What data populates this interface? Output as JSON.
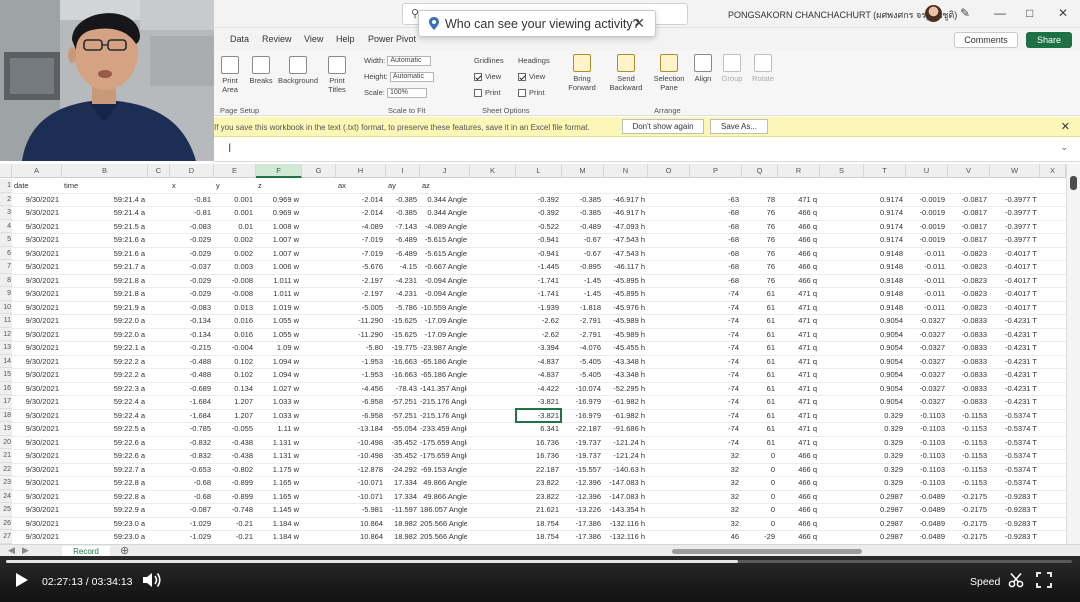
{
  "titlebar": {
    "account_name": "PONGSAKORN CHANCHACHURT (ผศพงศกร จรฐานชูติ)",
    "tooltip_text": "Who can see your viewing activity?"
  },
  "ribbon": {
    "tabs": [
      "Data",
      "Review",
      "View",
      "Help",
      "Power Pivot"
    ],
    "comments_label": "Comments",
    "share_label": "Share",
    "buttons": {
      "print_area": "Print Area",
      "breaks": "Breaks",
      "background": "Background",
      "print_titles": "Print Titles",
      "bring_forward": "Bring Forward",
      "send_backward": "Send Backward",
      "selection_pane": "Selection Pane",
      "align": "Align",
      "group": "Group",
      "rotate": "Rotate"
    },
    "scale_to_fit": {
      "width_label": "Width:",
      "width_value": "Automatic",
      "height_label": "Height:",
      "height_value": "Automatic",
      "scale_label": "Scale:",
      "scale_value": "100%"
    },
    "sheet_options": {
      "gridlines": "Gridlines",
      "headings": "Headings",
      "view": "View",
      "print": "Print"
    },
    "groups": {
      "page_setup": "Page Setup",
      "scale_to_fit": "Scale to Fit",
      "sheet_options": "Sheet Options",
      "arrange": "Arrange"
    }
  },
  "message_bar": {
    "text": "If you save this workbook in the text (.txt) format, to preserve these features, save it in an Excel file format.",
    "dont_show": "Don't show again",
    "save_as": "Save As..."
  },
  "grid": {
    "columns": [
      "A",
      "B",
      "C",
      "D",
      "E",
      "F",
      "G",
      "H",
      "I",
      "J",
      "K",
      "L",
      "M",
      "N",
      "O",
      "P",
      "Q",
      "R",
      "S",
      "T",
      "U",
      "V",
      "W",
      "X"
    ],
    "selected_column": "F",
    "header_row": {
      "A": "date",
      "B": "time",
      "D": "x",
      "E": "y",
      "F": "z",
      "H": "ax",
      "I": "ay",
      "J": "az"
    },
    "rows": [
      {
        "n": "2",
        "A": "9/30/2021",
        "B": "59:21.4 a",
        "D": "-0.81",
        "E": "0.001",
        "F": "0.969 w",
        "H": "-2.014",
        "I": "-0.385",
        "J": "0.344 Angle",
        "L": "-0.392",
        "M": "-0.385",
        "N": "-46.917 h",
        "P": "-63",
        "Q": "78",
        "R": "471 q",
        "T": "0.9174",
        "U": "-0.0019",
        "V": "-0.0817",
        "W": "-0.3977 T"
      },
      {
        "n": "3",
        "A": "9/30/2021",
        "B": "59:21.4 a",
        "D": "-0.81",
        "E": "0.001",
        "F": "0.969 w",
        "H": "-2.014",
        "I": "-0.385",
        "J": "0.344 Angle",
        "L": "-0.392",
        "M": "-0.385",
        "N": "-46.917 h",
        "P": "-68",
        "Q": "76",
        "R": "466 q",
        "T": "0.9174",
        "U": "-0.0019",
        "V": "-0.0817",
        "W": "-0.3977 T"
      },
      {
        "n": "4",
        "A": "9/30/2021",
        "B": "59:21.5 a",
        "D": "-0.083",
        "E": "0.01",
        "F": "1.008 w",
        "H": "-4.089",
        "I": "-7.143",
        "J": "-4.089 Angle",
        "L": "-0.522",
        "M": "-0.489",
        "N": "-47.093 h",
        "P": "-68",
        "Q": "76",
        "R": "466 q",
        "T": "0.9174",
        "U": "-0.0019",
        "V": "-0.0817",
        "W": "-0.3977 T"
      },
      {
        "n": "5",
        "A": "9/30/2021",
        "B": "59:21.6 a",
        "D": "-0.029",
        "E": "0.002",
        "F": "1.007 w",
        "H": "-7.019",
        "I": "-6.489",
        "J": "-5.615 Angle",
        "L": "-0.941",
        "M": "-0.67",
        "N": "-47.543 h",
        "P": "-68",
        "Q": "76",
        "R": "466 q",
        "T": "0.9174",
        "U": "-0.0019",
        "V": "-0.0817",
        "W": "-0.3977 T"
      },
      {
        "n": "6",
        "A": "9/30/2021",
        "B": "59:21.6 a",
        "D": "-0.029",
        "E": "0.002",
        "F": "1.007 w",
        "H": "-7.019",
        "I": "-6.489",
        "J": "-5.615 Angle",
        "L": "-0.941",
        "M": "-0.67",
        "N": "-47.543 h",
        "P": "-68",
        "Q": "76",
        "R": "466 q",
        "T": "0.9148",
        "U": "-0.011",
        "V": "-0.0823",
        "W": "-0.4017 T"
      },
      {
        "n": "7",
        "A": "9/30/2021",
        "B": "59:21.7 a",
        "D": "-0.037",
        "E": "0.003",
        "F": "1.006 w",
        "H": "-5.676",
        "I": "-4.15",
        "J": "-0.667 Angle",
        "L": "-1.445",
        "M": "-0.895",
        "N": "-46.117 h",
        "P": "-68",
        "Q": "76",
        "R": "466 q",
        "T": "0.9148",
        "U": "-0.011",
        "V": "-0.0823",
        "W": "-0.4017 T"
      },
      {
        "n": "8",
        "A": "9/30/2021",
        "B": "59:21.8 a",
        "D": "-0.029",
        "E": "-0.008",
        "F": "1.011 w",
        "H": "-2.197",
        "I": "-4.231",
        "J": "-0.094 Angle",
        "L": "-1.741",
        "M": "-1.45",
        "N": "-45.895 h",
        "P": "-68",
        "Q": "76",
        "R": "466 q",
        "T": "0.9148",
        "U": "-0.011",
        "V": "-0.0823",
        "W": "-0.4017 T"
      },
      {
        "n": "9",
        "A": "9/30/2021",
        "B": "59:21.8 a",
        "D": "-0.029",
        "E": "-0.008",
        "F": "1.011 w",
        "H": "-2.197",
        "I": "-4.231",
        "J": "-0.094 Angle",
        "L": "-1.741",
        "M": "-1.45",
        "N": "-45.895 h",
        "P": "-74",
        "Q": "61",
        "R": "471 q",
        "T": "0.9148",
        "U": "-0.011",
        "V": "-0.0823",
        "W": "-0.4017 T"
      },
      {
        "n": "10",
        "A": "9/30/2021",
        "B": "59:21.9 a",
        "D": "-0.083",
        "E": "0.013",
        "F": "1.019 w",
        "H": "-5.005",
        "I": "-5.786",
        "J": "-10.559 Angle",
        "L": "-1.939",
        "M": "-1.818",
        "N": "-45.976 h",
        "P": "-74",
        "Q": "61",
        "R": "471 q",
        "T": "0.9148",
        "U": "-0.011",
        "V": "-0.0823",
        "W": "-0.4017 T"
      },
      {
        "n": "11",
        "A": "9/30/2021",
        "B": "59:22.0 a",
        "D": "-0.134",
        "E": "0.016",
        "F": "1.055 w",
        "H": "-11.290",
        "I": "-15.625",
        "J": "-17.09 Angle",
        "L": "-2.62",
        "M": "-2.791",
        "N": "-45.989 h",
        "P": "-74",
        "Q": "61",
        "R": "471 q",
        "T": "0.9054",
        "U": "-0.0327",
        "V": "-0.0833",
        "W": "-0.4231 T"
      },
      {
        "n": "12",
        "A": "9/30/2021",
        "B": "59:22.0 a",
        "D": "-0.134",
        "E": "0.016",
        "F": "1.055 w",
        "H": "-11.290",
        "I": "-15.625",
        "J": "-17.09 Angle",
        "L": "-2.62",
        "M": "-2.791",
        "N": "-45.989 h",
        "P": "-74",
        "Q": "61",
        "R": "471 q",
        "T": "0.9054",
        "U": "-0.0327",
        "V": "-0.0833",
        "W": "-0.4231 T"
      },
      {
        "n": "13",
        "A": "9/30/2021",
        "B": "59:22.1 a",
        "D": "-0.215",
        "E": "-0.004",
        "F": "1.09 w",
        "H": "-5.80",
        "I": "-19.775",
        "J": "-23.987 Angle",
        "L": "-3.394",
        "M": "-4.076",
        "N": "-45.455 h",
        "P": "-74",
        "Q": "61",
        "R": "471 q",
        "T": "0.9054",
        "U": "-0.0327",
        "V": "-0.0833",
        "W": "-0.4231 T"
      },
      {
        "n": "14",
        "A": "9/30/2021",
        "B": "59:22.2 a",
        "D": "-0.488",
        "E": "0.102",
        "F": "1.094 w",
        "H": "-1.953",
        "I": "-16.663",
        "J": "-65.186 Angle",
        "L": "-4.837",
        "M": "-5.405",
        "N": "-43.348 h",
        "P": "-74",
        "Q": "61",
        "R": "471 q",
        "T": "0.9054",
        "U": "-0.0327",
        "V": "-0.0833",
        "W": "-0.4231 T"
      },
      {
        "n": "15",
        "A": "9/30/2021",
        "B": "59:22.2 a",
        "D": "-0.488",
        "E": "0.102",
        "F": "1.094 w",
        "H": "-1.953",
        "I": "-16.663",
        "J": "-65.186 Angle",
        "L": "-4.837",
        "M": "-5.405",
        "N": "-43.348 h",
        "P": "-74",
        "Q": "61",
        "R": "471 q",
        "T": "0.9054",
        "U": "-0.0327",
        "V": "-0.0833",
        "W": "-0.4231 T"
      },
      {
        "n": "16",
        "A": "9/30/2021",
        "B": "59:22.3 a",
        "D": "-0.689",
        "E": "0.134",
        "F": "1.027 w",
        "H": "-4.456",
        "I": "-78.43",
        "J": "-141.357 Angle",
        "L": "-4.422",
        "M": "-10.074",
        "N": "-52.295 h",
        "P": "-74",
        "Q": "61",
        "R": "471 q",
        "T": "0.9054",
        "U": "-0.0327",
        "V": "-0.0833",
        "W": "-0.4231 T"
      },
      {
        "n": "17",
        "A": "9/30/2021",
        "B": "59:22.4 a",
        "D": "-1.684",
        "E": "1.207",
        "F": "1.033 w",
        "H": "-6.958",
        "I": "-57.251",
        "J": "-215.176 Angle",
        "L": "-3.821",
        "M": "-16.979",
        "N": "-61.982 h",
        "P": "-74",
        "Q": "61",
        "R": "471 q",
        "T": "0.9054",
        "U": "-0.0327",
        "V": "-0.0833",
        "W": "-0.4231 T"
      },
      {
        "n": "18",
        "A": "9/30/2021",
        "B": "59:22.4 a",
        "D": "-1.684",
        "E": "1.207",
        "F": "1.033 w",
        "H": "-6.958",
        "I": "-57.251",
        "J": "-215.176 Angle",
        "L": "-3.821",
        "M": "-16.979",
        "N": "-61.982 h",
        "P": "-74",
        "Q": "61",
        "R": "471 q",
        "T": "0.329",
        "U": "-0.1103",
        "V": "-0.1153",
        "W": "-0.5374 T"
      },
      {
        "n": "19",
        "A": "9/30/2021",
        "B": "59:22.5 a",
        "D": "-0.785",
        "E": "-0.055",
        "F": "1.11 w",
        "H": "-13.184",
        "I": "-55.054",
        "J": "-233.459 Angle",
        "L": "6.341",
        "M": "-22.187",
        "N": "-91.686 h",
        "P": "-74",
        "Q": "61",
        "R": "471 q",
        "T": "0.329",
        "U": "-0.1103",
        "V": "-0.1153",
        "W": "-0.5374 T"
      },
      {
        "n": "20",
        "A": "9/30/2021",
        "B": "59:22.6 a",
        "D": "-0.832",
        "E": "-0.438",
        "F": "1.131 w",
        "H": "-10.498",
        "I": "-35.452",
        "J": "-175.659 Angle",
        "L": "16.736",
        "M": "-19.737",
        "N": "-121.24 h",
        "P": "-74",
        "Q": "61",
        "R": "471 q",
        "T": "0.329",
        "U": "-0.1103",
        "V": "-0.1153",
        "W": "-0.5374 T"
      },
      {
        "n": "21",
        "A": "9/30/2021",
        "B": "59:22.6 a",
        "D": "-0.832",
        "E": "-0.438",
        "F": "1.131 w",
        "H": "-10.498",
        "I": "-35.452",
        "J": "-175.659 Angle",
        "L": "16.736",
        "M": "-19.737",
        "N": "-121.24 h",
        "P": "32",
        "Q": "0",
        "R": "466 q",
        "T": "0.329",
        "U": "-0.1103",
        "V": "-0.1153",
        "W": "-0.5374 T"
      },
      {
        "n": "22",
        "A": "9/30/2021",
        "B": "59:22.7 a",
        "D": "-0.653",
        "E": "-0.802",
        "F": "1.175 w",
        "H": "-12.878",
        "I": "-24.292",
        "J": "-69.153 Angle",
        "L": "22.187",
        "M": "-15.557",
        "N": "-140.63 h",
        "P": "32",
        "Q": "0",
        "R": "466 q",
        "T": "0.329",
        "U": "-0.1103",
        "V": "-0.1153",
        "W": "-0.5374 T"
      },
      {
        "n": "23",
        "A": "9/30/2021",
        "B": "59:22.8 a",
        "D": "-0.68",
        "E": "-0.899",
        "F": "1.165 w",
        "H": "-10.071",
        "I": "17.334",
        "J": "49.866 Angle",
        "L": "23.822",
        "M": "-12.396",
        "N": "-147.083 h",
        "P": "32",
        "Q": "0",
        "R": "466 q",
        "T": "0.329",
        "U": "-0.1103",
        "V": "-0.1153",
        "W": "-0.5374 T"
      },
      {
        "n": "24",
        "A": "9/30/2021",
        "B": "59:22.8 a",
        "D": "-0.68",
        "E": "-0.899",
        "F": "1.165 w",
        "H": "-10.071",
        "I": "17.334",
        "J": "49.866 Angle",
        "L": "23.822",
        "M": "-12.396",
        "N": "-147.083 h",
        "P": "32",
        "Q": "0",
        "R": "466 q",
        "T": "0.2987",
        "U": "-0.0489",
        "V": "-0.2175",
        "W": "-0.9283 T"
      },
      {
        "n": "25",
        "A": "9/30/2021",
        "B": "59:22.9 a",
        "D": "-0.087",
        "E": "-0.748",
        "F": "1.145 w",
        "H": "-5.981",
        "I": "-11.597",
        "J": "186.057 Angle",
        "L": "21.621",
        "M": "-13.226",
        "N": "-143.354 h",
        "P": "32",
        "Q": "0",
        "R": "466 q",
        "T": "0.2987",
        "U": "-0.0489",
        "V": "-0.2175",
        "W": "-0.9283 T"
      },
      {
        "n": "26",
        "A": "9/30/2021",
        "B": "59:23.0 a",
        "D": "-1.029",
        "E": "-0.21",
        "F": "1.184 w",
        "H": "10.864",
        "I": "18.982",
        "J": "205.566 Angle",
        "L": "18.754",
        "M": "-17.386",
        "N": "-132.116 h",
        "P": "32",
        "Q": "0",
        "R": "466 q",
        "T": "0.2987",
        "U": "-0.0489",
        "V": "-0.2175",
        "W": "-0.9283 T"
      },
      {
        "n": "27",
        "A": "9/30/2021",
        "B": "59:23.0 a",
        "D": "-1.029",
        "E": "-0.21",
        "F": "1.184 w",
        "H": "10.864",
        "I": "18.982",
        "J": "205.566 Angle",
        "L": "18.754",
        "M": "-17.386",
        "N": "-132.116 h",
        "P": "46",
        "Q": "-29",
        "R": "466 q",
        "T": "0.2987",
        "U": "-0.0489",
        "V": "-0.2175",
        "W": "-0.9283 T"
      }
    ]
  },
  "sheet": {
    "tab_label": "Record"
  },
  "player": {
    "current_time": "02:27:13",
    "duration": "03:34:13",
    "progress_fraction": 0.6864,
    "speed_label": "Speed"
  }
}
